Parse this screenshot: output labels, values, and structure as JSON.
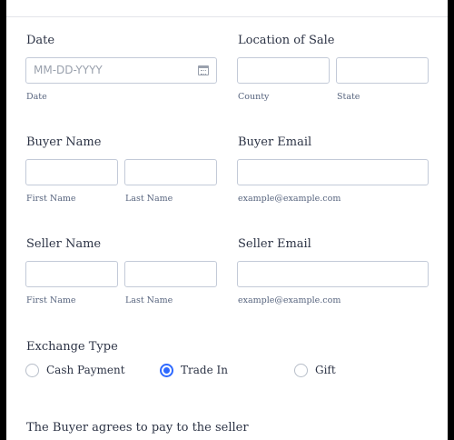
{
  "date": {
    "label": "Date",
    "placeholder": "MM-DD-YYYY",
    "sublabel": "Date"
  },
  "location": {
    "label": "Location of Sale",
    "county_sublabel": "County",
    "state_sublabel": "State"
  },
  "buyer": {
    "name_label": "Buyer Name",
    "first_sublabel": "First Name",
    "last_sublabel": "Last Name",
    "email_label": "Buyer Email",
    "email_sublabel": "example@example.com"
  },
  "seller": {
    "name_label": "Seller Name",
    "first_sublabel": "First Name",
    "last_sublabel": "Last Name",
    "email_label": "Seller Email",
    "email_sublabel": "example@example.com"
  },
  "exchange": {
    "label": "Exchange Type",
    "options": [
      "Cash Payment",
      "Trade In",
      "Gift"
    ],
    "selected": "Trade In"
  },
  "agreement": {
    "text": "The Buyer agrees to pay to the seller"
  },
  "colors": {
    "accent": "#2e69ff",
    "field_border": "#c3cad8",
    "text": "#2c3345"
  },
  "icons": [
    "calendar-icon"
  ]
}
